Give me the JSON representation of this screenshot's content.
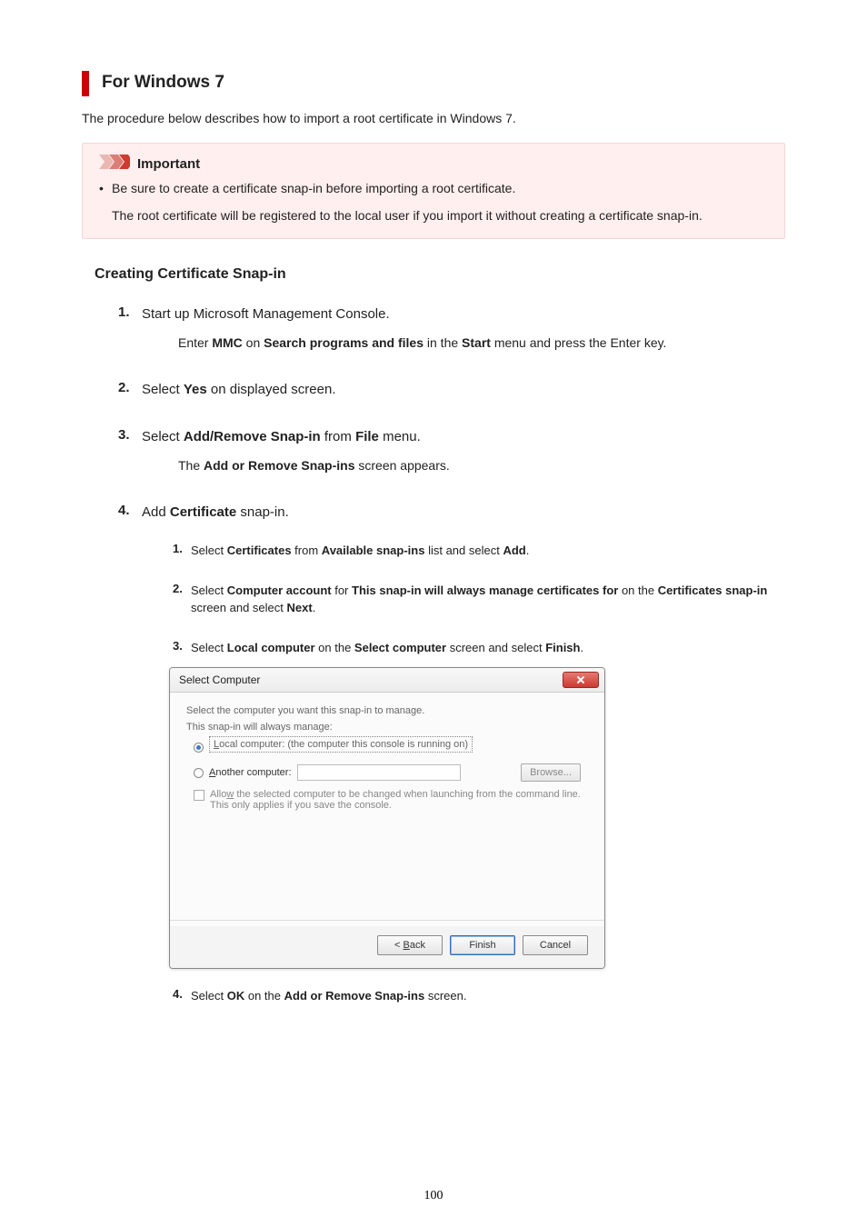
{
  "heading": "For Windows 7",
  "intro": "The procedure below describes how to import a root certificate in Windows 7.",
  "important": {
    "label": "Important",
    "bullet": "Be sure to create a certificate snap-in before importing a root certificate.",
    "sub": "The root certificate will be registered to the local user if you import it without creating a certificate snap-in."
  },
  "section": "Creating Certificate Snap-in",
  "steps": {
    "s1": {
      "num": "1.",
      "title": "Start up Microsoft Management Console.",
      "sub_pre": "Enter ",
      "sub_b1": "MMC",
      "sub_mid1": " on ",
      "sub_b2": "Search programs and files",
      "sub_mid2": " in the ",
      "sub_b3": "Start",
      "sub_post": " menu and press the Enter key."
    },
    "s2": {
      "num": "2.",
      "pre": "Select ",
      "b": "Yes",
      "post": " on displayed screen."
    },
    "s3": {
      "num": "3.",
      "pre": "Select ",
      "b1": "Add/Remove Snap-in",
      "mid": " from ",
      "b2": "File",
      "post": " menu.",
      "sub_pre": "The ",
      "sub_b": "Add or Remove Snap-ins",
      "sub_post": " screen appears."
    },
    "s4": {
      "num": "4.",
      "pre": "Add ",
      "b": "Certificate",
      "post": " snap-in."
    }
  },
  "substeps": {
    "a": {
      "num": "1.",
      "pre": "Select ",
      "b1": "Certificates",
      "mid1": " from ",
      "b2": "Available snap-ins",
      "mid2": " list and select ",
      "b3": "Add",
      "post": "."
    },
    "b": {
      "num": "2.",
      "pre": "Select ",
      "b1": "Computer account",
      "mid1": " for ",
      "b2": "This snap-in will always manage certificates for",
      "mid2": " on the ",
      "b3": "Certificates snap-in",
      "mid3": " screen and select ",
      "b4": "Next",
      "post": "."
    },
    "c": {
      "num": "3.",
      "pre": "Select ",
      "b1": "Local computer",
      "mid1": " on the ",
      "b2": "Select computer",
      "mid2": " screen and select ",
      "b3": "Finish",
      "post": "."
    },
    "d": {
      "num": "4.",
      "pre": "Select ",
      "b1": "OK",
      "mid1": " on the ",
      "b2": "Add or Remove Snap-ins",
      "post": " screen."
    }
  },
  "dialog": {
    "title": "Select Computer",
    "line1": "Select the computer you want this snap-in to manage.",
    "line2": "This snap-in will always manage:",
    "opt_local_pre": "L",
    "opt_local": "ocal computer:  (the computer this console is running on)",
    "opt_another_pre": "A",
    "opt_another": "nother computer:",
    "browse": "Browse...",
    "chk": "Allow the selected computer to be changed when launching from the command line. This only applies if you save the console.",
    "chk_u": "w",
    "btn_back": "< Back",
    "btn_back_u": "B",
    "btn_finish": "Finish",
    "btn_cancel": "Cancel"
  },
  "page_number": "100"
}
